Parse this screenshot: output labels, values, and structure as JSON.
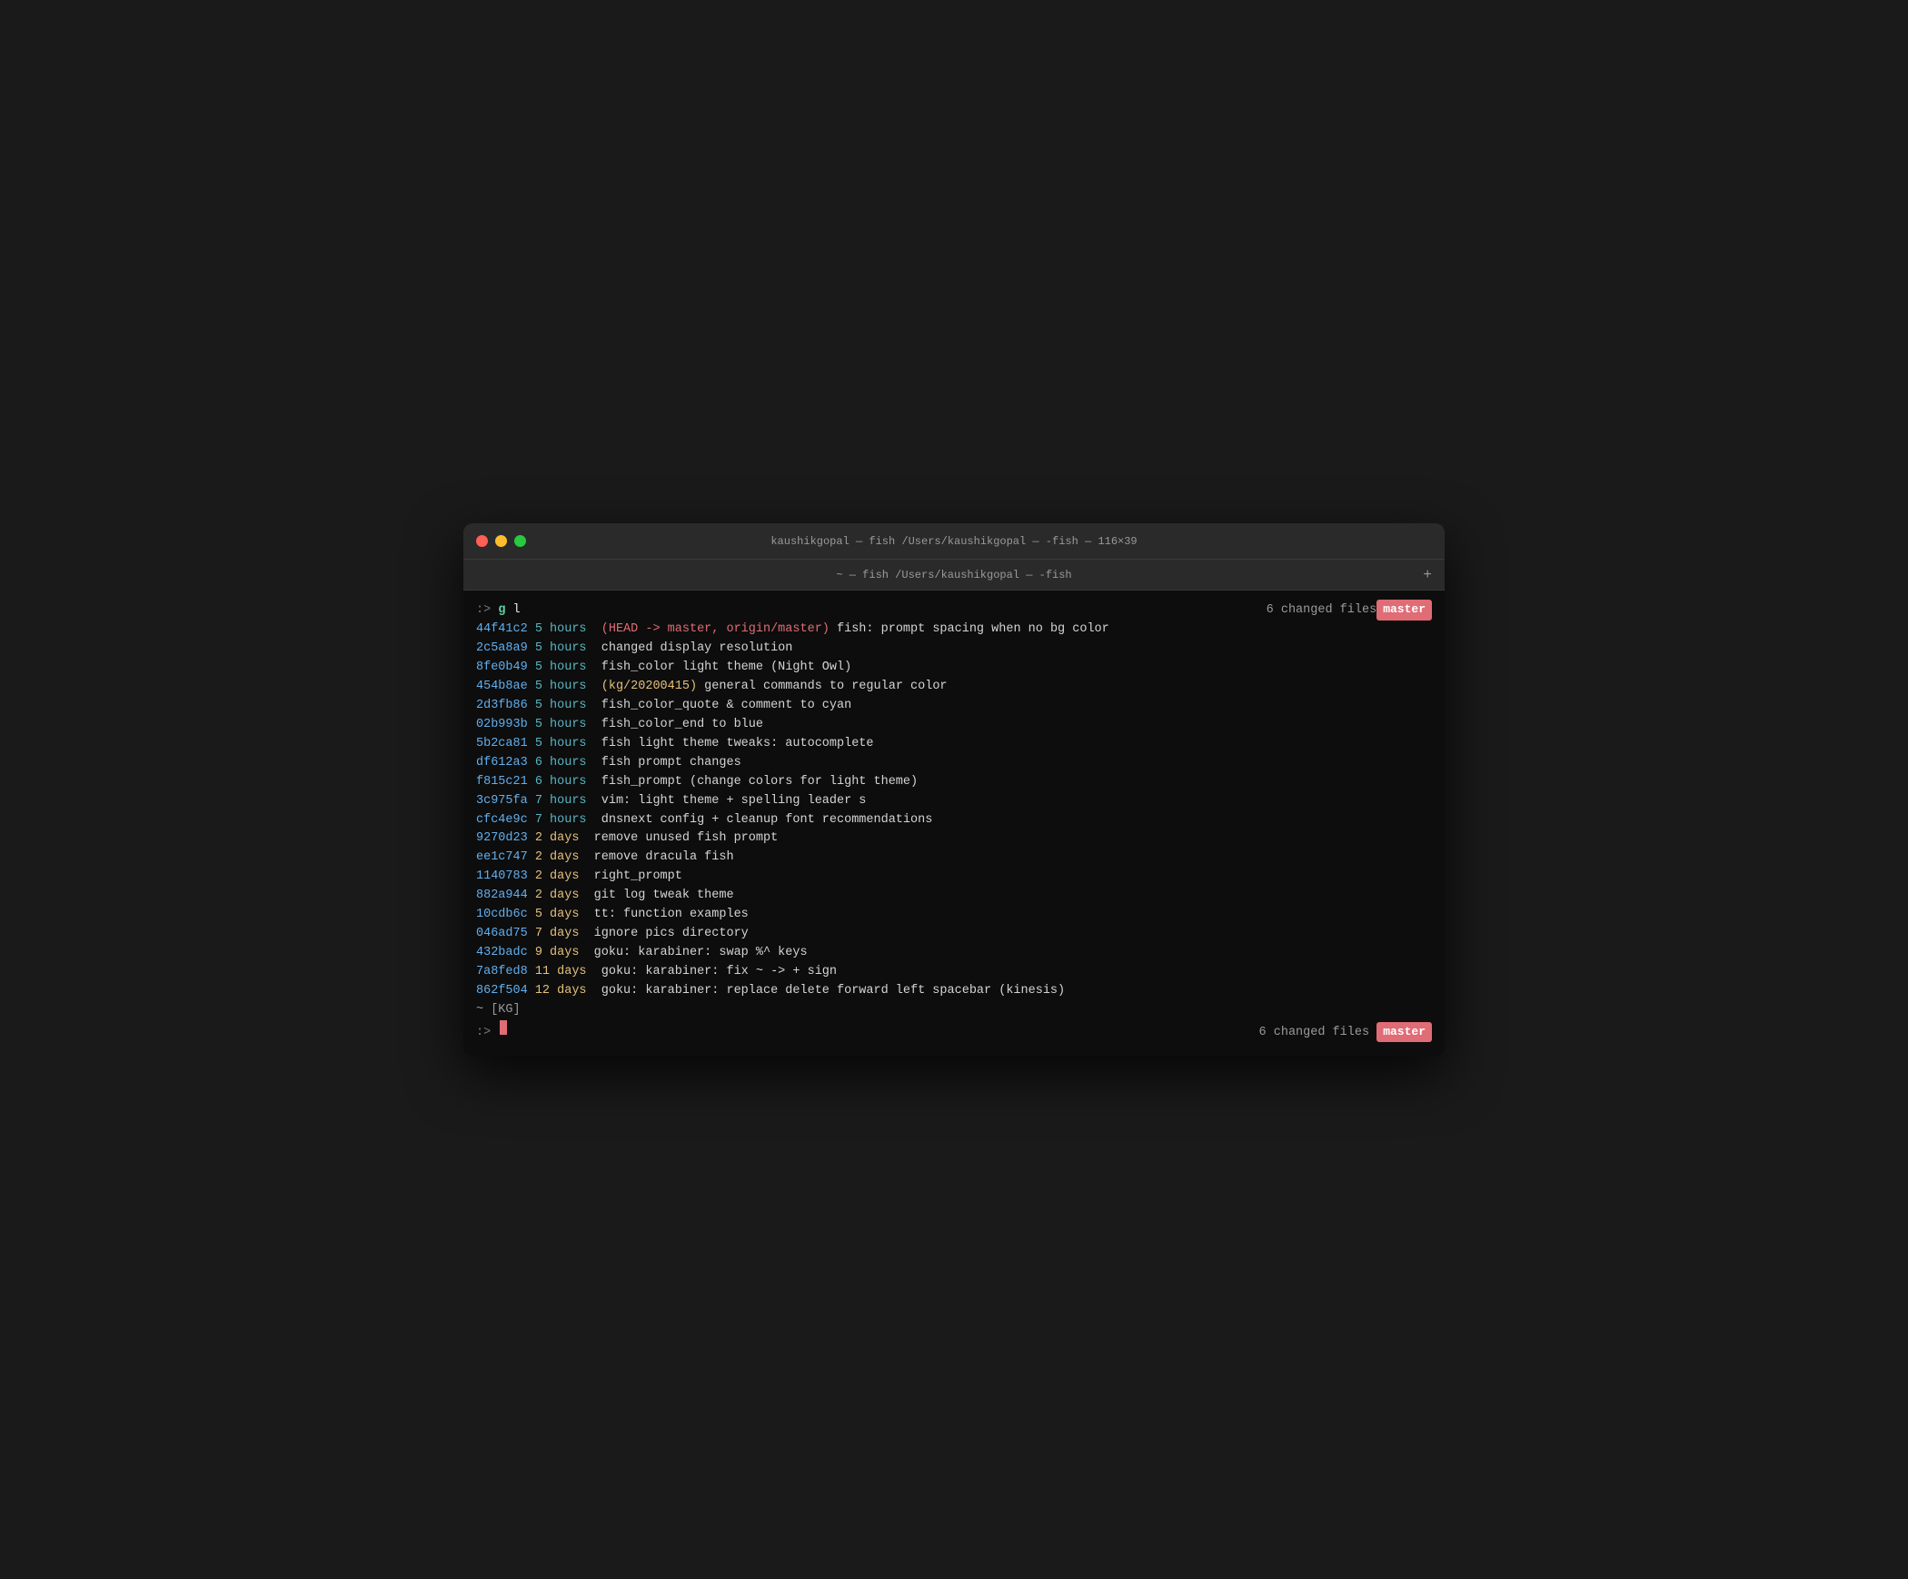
{
  "window": {
    "title": "kaushikgopal — fish /Users/kaushikgopal — -fish — 116×39",
    "tab_label": "~ — fish /Users/kaushikgopal — -fish",
    "plus_icon": "+"
  },
  "terminal": {
    "prompt1": ":> ",
    "command_g": "g",
    "command_rest": " l",
    "status": {
      "changed_files": "6 changed files",
      "branch": "master"
    },
    "commits": [
      {
        "hash": "44f41c2",
        "time": "5 hours",
        "time_class": "time-5h",
        "head_ref": "(HEAD -> master, origin/master)",
        "message": " fish: prompt spacing when no bg color"
      },
      {
        "hash": "2c5a8a9",
        "time": "5 hours",
        "time_class": "time-5h",
        "head_ref": "",
        "message": "changed display resolution"
      },
      {
        "hash": "8fe0b49",
        "time": "5 hours",
        "time_class": "time-5h",
        "head_ref": "",
        "message": "fish_color light theme (Night Owl)"
      },
      {
        "hash": "454b8ae",
        "time": "5 hours",
        "time_class": "time-5h",
        "kg_ref": "(kg/20200415)",
        "message": " general commands to regular color"
      },
      {
        "hash": "2d3fb86",
        "time": "5 hours",
        "time_class": "time-5h",
        "head_ref": "",
        "message": "fish_color_quote & comment to cyan"
      },
      {
        "hash": "02b993b",
        "time": "5 hours",
        "time_class": "time-5h",
        "head_ref": "",
        "message": "fish_color_end to blue"
      },
      {
        "hash": "5b2ca81",
        "time": "5 hours",
        "time_class": "time-5h",
        "head_ref": "",
        "message": "fish light theme tweaks: autocomplete"
      },
      {
        "hash": "df612a3",
        "time": "6 hours",
        "time_class": "time-6h",
        "head_ref": "",
        "message": "fish prompt changes"
      },
      {
        "hash": "f815c21",
        "time": "6 hours",
        "time_class": "time-6h",
        "head_ref": "",
        "message": "fish_prompt (change colors for light theme)"
      },
      {
        "hash": "3c975fa",
        "time": "7 hours",
        "time_class": "time-7h",
        "head_ref": "",
        "message": "vim: light theme + spelling leader s"
      },
      {
        "hash": "cfc4e9c",
        "time": "7 hours",
        "time_class": "time-7h",
        "head_ref": "",
        "message": "dnsnext config + cleanup font recommendations"
      },
      {
        "hash": "9270d23",
        "time": "2 days",
        "time_class": "time-2d",
        "head_ref": "",
        "message": "remove unused fish prompt"
      },
      {
        "hash": "ee1c747",
        "time": "2 days",
        "time_class": "time-2d",
        "head_ref": "",
        "message": "remove dracula fish"
      },
      {
        "hash": "1140783",
        "time": "2 days",
        "time_class": "time-2d",
        "head_ref": "",
        "message": "right_prompt"
      },
      {
        "hash": "882a944",
        "time": "2 days",
        "time_class": "time-2d",
        "head_ref": "",
        "message": "git log tweak theme"
      },
      {
        "hash": "10cdb6c",
        "time": "5 days",
        "time_class": "time-5d",
        "head_ref": "",
        "message": "tt: function examples"
      },
      {
        "hash": "046ad75",
        "time": "7 days",
        "time_class": "time-7d",
        "head_ref": "",
        "message": "ignore pics directory"
      },
      {
        "hash": "432badc",
        "time": "9 days",
        "time_class": "time-9d",
        "head_ref": "",
        "message": "goku: karabiner: swap %^ keys"
      },
      {
        "hash": "7a8fed8",
        "time": "11 days",
        "time_class": "time-11d",
        "head_ref": "",
        "message": "goku: karabiner: fix ~ -> + sign"
      },
      {
        "hash": "862f504",
        "time": "12 days",
        "time_class": "time-12d",
        "head_ref": "",
        "message": "goku: karabiner: replace delete forward left spacebar (kinesis)"
      }
    ],
    "tilde_kg": "~ [KG]",
    "prompt2": ":> "
  }
}
